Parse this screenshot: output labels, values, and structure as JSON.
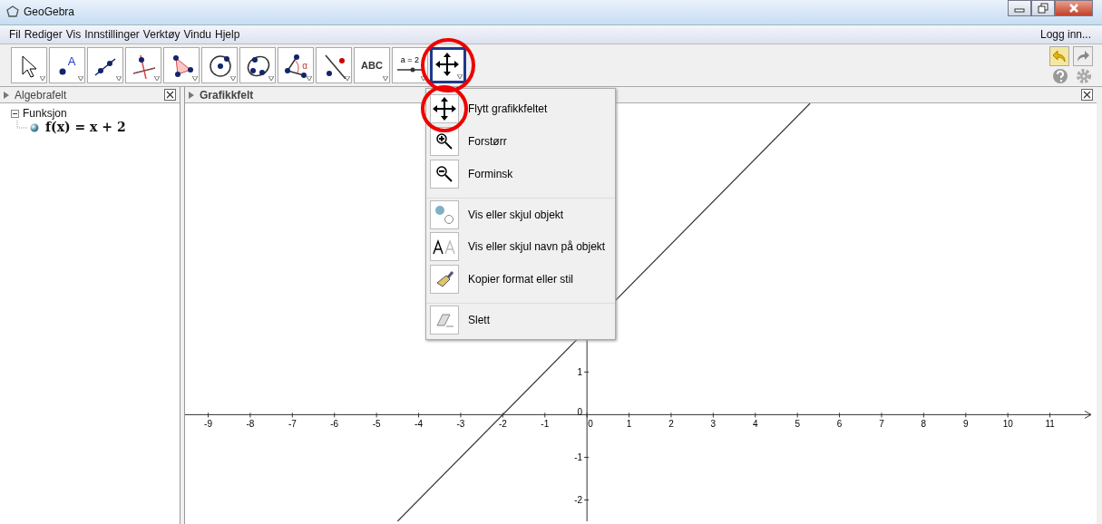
{
  "window": {
    "title": "GeoGebra"
  },
  "menu": [
    "Fil",
    "Rediger",
    "Vis",
    "Innstillinger",
    "Verktøy",
    "Vindu",
    "Hjelp"
  ],
  "login": "Logg inn...",
  "tools": [
    {
      "kind": "pointer",
      "selected": false,
      "highlighted": false
    },
    {
      "kind": "point",
      "label": "A",
      "selected": false,
      "highlighted": false
    },
    {
      "kind": "line",
      "selected": false,
      "highlighted": false
    },
    {
      "kind": "perpendicular",
      "selected": false,
      "highlighted": false
    },
    {
      "kind": "polygon",
      "selected": false,
      "highlighted": false
    },
    {
      "kind": "circle",
      "selected": false,
      "highlighted": false
    },
    {
      "kind": "conic",
      "selected": false,
      "highlighted": false
    },
    {
      "kind": "angle",
      "label": "α",
      "selected": false,
      "highlighted": false
    },
    {
      "kind": "reflect",
      "selected": false,
      "highlighted": false
    },
    {
      "kind": "text",
      "label": "ABC",
      "selected": false,
      "highlighted": false
    },
    {
      "kind": "slider",
      "label": "a = 2",
      "selected": false,
      "highlighted": false
    },
    {
      "kind": "move",
      "selected": true,
      "highlighted": true
    }
  ],
  "algebra": {
    "title": "Algebrafelt",
    "items": [
      {
        "label": "Funksjon",
        "expanded": true,
        "children": [
          {
            "label": "f(x) = x + 2"
          }
        ]
      }
    ]
  },
  "graphics": {
    "title": "Grafikkfelt",
    "chart_data": {
      "type": "line",
      "x": [
        -4.5,
        5.3
      ],
      "series": [
        {
          "color": "#333333",
          "values": [
            -2.5,
            7.3
          ]
        }
      ],
      "xlim": [
        -9.55,
        12
      ],
      "ylim": [
        -2.5,
        7.3
      ],
      "xticks": [
        -9,
        -8,
        -7,
        -6,
        -5,
        -4,
        -3,
        -2,
        -1,
        0,
        1,
        2,
        3,
        4,
        5,
        6,
        7,
        8,
        9,
        10,
        11
      ],
      "yticks": [
        -2,
        -1,
        0,
        1
      ]
    }
  },
  "dropdown": [
    {
      "kind": "move",
      "label": "Flytt grafikkfeltet",
      "divider_above": false,
      "highlighted": true
    },
    {
      "kind": "zoomin",
      "label": "Forstørr",
      "divider_above": false,
      "highlighted": false
    },
    {
      "kind": "zoomout",
      "label": "Forminsk",
      "divider_above": false,
      "highlighted": false
    },
    {
      "kind": "showhide",
      "label": "Vis eller skjul objekt",
      "divider_above": true,
      "highlighted": false
    },
    {
      "kind": "labels",
      "label": "Vis eller skjul navn på objekt",
      "divider_above": false,
      "highlighted": false
    },
    {
      "kind": "copystyle",
      "label": "Kopier format eller stil",
      "divider_above": false,
      "highlighted": false
    },
    {
      "kind": "delete",
      "label": "Slett",
      "divider_above": true,
      "highlighted": false
    }
  ]
}
